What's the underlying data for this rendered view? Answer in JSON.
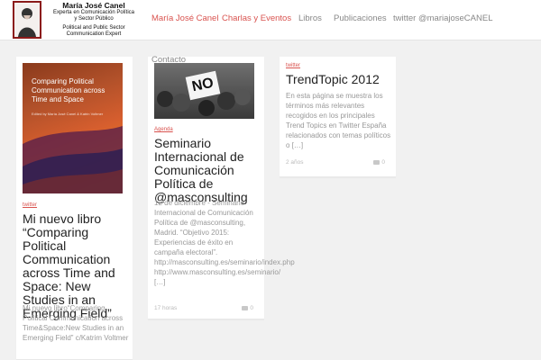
{
  "brand": {
    "name": "María José Canel",
    "tagline1": "Experta en Comunicación Política",
    "tagline2": "y Sector Público",
    "tagline3": "Political and Public Sector",
    "tagline4": "Communication Expert"
  },
  "nav": {
    "items": [
      "María José Canel",
      "Charlas y Eventos",
      "Libros",
      "Publicaciones",
      "twitter @mariajoseCANEL"
    ],
    "contacto": "Contacto"
  },
  "colors": {
    "accent": "#d9534f",
    "text": "#222222",
    "muted": "#999999",
    "background": "#f1f1f1"
  },
  "posts": [
    {
      "category": "twitter",
      "title": "Mi nuevo libro “Comparing Political Communication across Time and Space: New Studies in an Emerging Field”",
      "excerpt": "Mi nuevo libro“Comparing Political Communication across Time&Space:New Studies in an Emerging Field” c/Katrim Voltmer",
      "image_book_title": "Comparing Political Communication across Time and Space",
      "image_book_editors": "Edited by María José Canel & Katrin Voltmer"
    },
    {
      "category": "Agenda",
      "title": "Seminario Internacional de Comunicación Política de @masconsulting",
      "excerpt": "12 de diciembre - Seminario Internacional de Comunicación Política de @masconsulting, Madrid. “Objetivo 2015: Experiencias de éxito en campaña electoral”. http://masconsulting.es/seminario/index.php http://www.masconsulting.es/seminario/",
      "more": "[…]",
      "date": "17 horas",
      "comments": "0",
      "image_sign": "NO"
    },
    {
      "category": "twitter",
      "title": "TrendTopic 2012",
      "excerpt": "En esta página se muestra los términos más relevantes recogidos en los principales Trend Topics en Twitter España relacionados con temas políticos o",
      "more": "[…]",
      "date": "2 años",
      "comments": "0"
    }
  ]
}
